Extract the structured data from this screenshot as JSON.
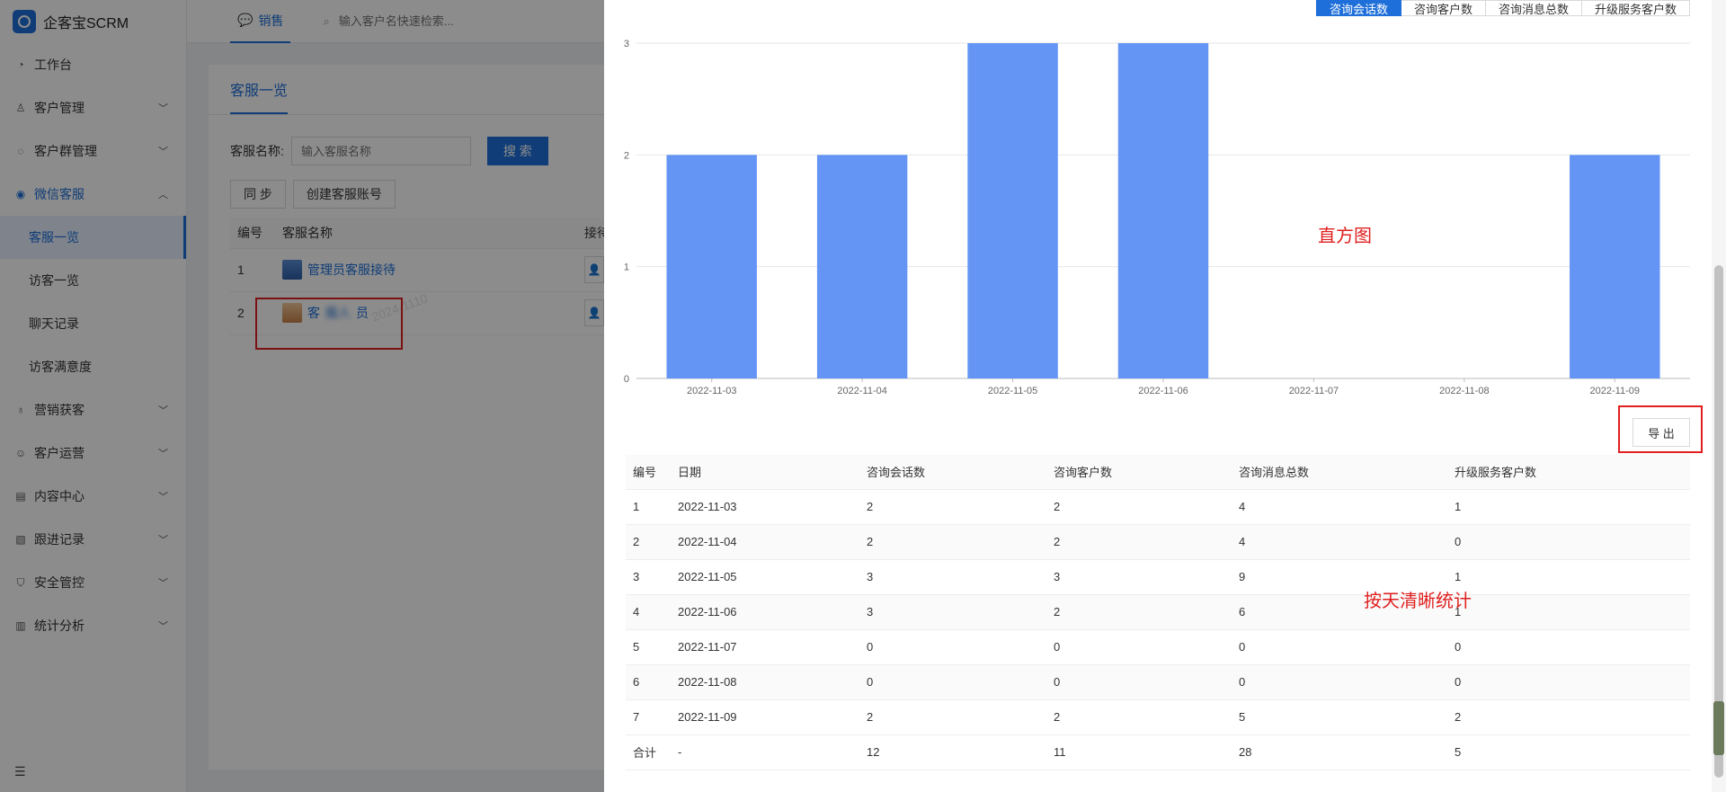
{
  "brand": {
    "name": "企客宝SCRM"
  },
  "sidebar": {
    "items": [
      {
        "label": "工作台",
        "icon": "dashboard-icon",
        "has_children": false
      },
      {
        "label": "客户管理",
        "icon": "user-icon",
        "has_children": true
      },
      {
        "label": "客户群管理",
        "icon": "group-chat-icon",
        "has_children": true
      },
      {
        "label": "微信客服",
        "icon": "chat-icon",
        "has_children": true,
        "open": true,
        "children": [
          {
            "label": "客服一览",
            "active": true
          },
          {
            "label": "访客一览"
          },
          {
            "label": "聊天记录"
          },
          {
            "label": "访客满意度"
          }
        ]
      },
      {
        "label": "营销获客",
        "icon": "bulb-icon",
        "has_children": true
      },
      {
        "label": "客户运营",
        "icon": "smile-icon",
        "has_children": true
      },
      {
        "label": "内容中心",
        "icon": "content-icon",
        "has_children": true
      },
      {
        "label": "跟进记录",
        "icon": "record-icon",
        "has_children": true
      },
      {
        "label": "安全管控",
        "icon": "shield-icon",
        "has_children": true
      },
      {
        "label": "统计分析",
        "icon": "bar-chart-icon",
        "has_children": true
      }
    ]
  },
  "topbar": {
    "tab_label": "销售",
    "search_placeholder": "输入客户名快速检索..."
  },
  "main": {
    "tab_label": "客服一览",
    "filter": {
      "label": "客服名称:",
      "placeholder": "输入客服名称",
      "search_button": "搜 索"
    },
    "buttons": {
      "sync": "同 步",
      "create": "创建客服账号"
    },
    "table": {
      "headers": [
        "编号",
        "客服名称",
        "接待"
      ],
      "rows": [
        {
          "id": "1",
          "name": "管理员客服接待"
        },
        {
          "id": "2",
          "name_visible_start": "客",
          "name_blurred": "服人",
          "name_visible_end": "员"
        }
      ]
    },
    "watermark": "2024-1110"
  },
  "drawer": {
    "metric_tabs": [
      "咨询会话数",
      "咨询客户数",
      "咨询消息总数",
      "升级服务客户数"
    ],
    "active_metric": 0,
    "annotations": {
      "chart": "直方图",
      "table": "按天清晰统计"
    },
    "export_label": "导 出",
    "table": {
      "headers": [
        "编号",
        "日期",
        "咨询会话数",
        "咨询客户数",
        "咨询消息总数",
        "升级服务客户数"
      ],
      "rows": [
        [
          "1",
          "2022-11-03",
          "2",
          "2",
          "4",
          "1"
        ],
        [
          "2",
          "2022-11-04",
          "2",
          "2",
          "4",
          "0"
        ],
        [
          "3",
          "2022-11-05",
          "3",
          "3",
          "9",
          "1"
        ],
        [
          "4",
          "2022-11-06",
          "3",
          "2",
          "6",
          "1"
        ],
        [
          "5",
          "2022-11-07",
          "0",
          "0",
          "0",
          "0"
        ],
        [
          "6",
          "2022-11-08",
          "0",
          "0",
          "0",
          "0"
        ],
        [
          "7",
          "2022-11-09",
          "2",
          "2",
          "5",
          "2"
        ]
      ],
      "total": [
        "合计",
        "-",
        "12",
        "11",
        "28",
        "5"
      ]
    }
  },
  "chart_data": {
    "type": "bar",
    "categories": [
      "2022-11-03",
      "2022-11-04",
      "2022-11-05",
      "2022-11-06",
      "2022-11-07",
      "2022-11-08",
      "2022-11-09"
    ],
    "values": [
      2,
      2,
      3,
      3,
      0,
      0,
      2
    ],
    "yticks": [
      "0",
      "1",
      "2",
      "3"
    ],
    "ylim": [
      0,
      3
    ],
    "grid": true,
    "color": "#6495f5"
  },
  "colors": {
    "primary": "#1e6fd9",
    "bar": "#6495f5",
    "annotation": "#e02020"
  }
}
